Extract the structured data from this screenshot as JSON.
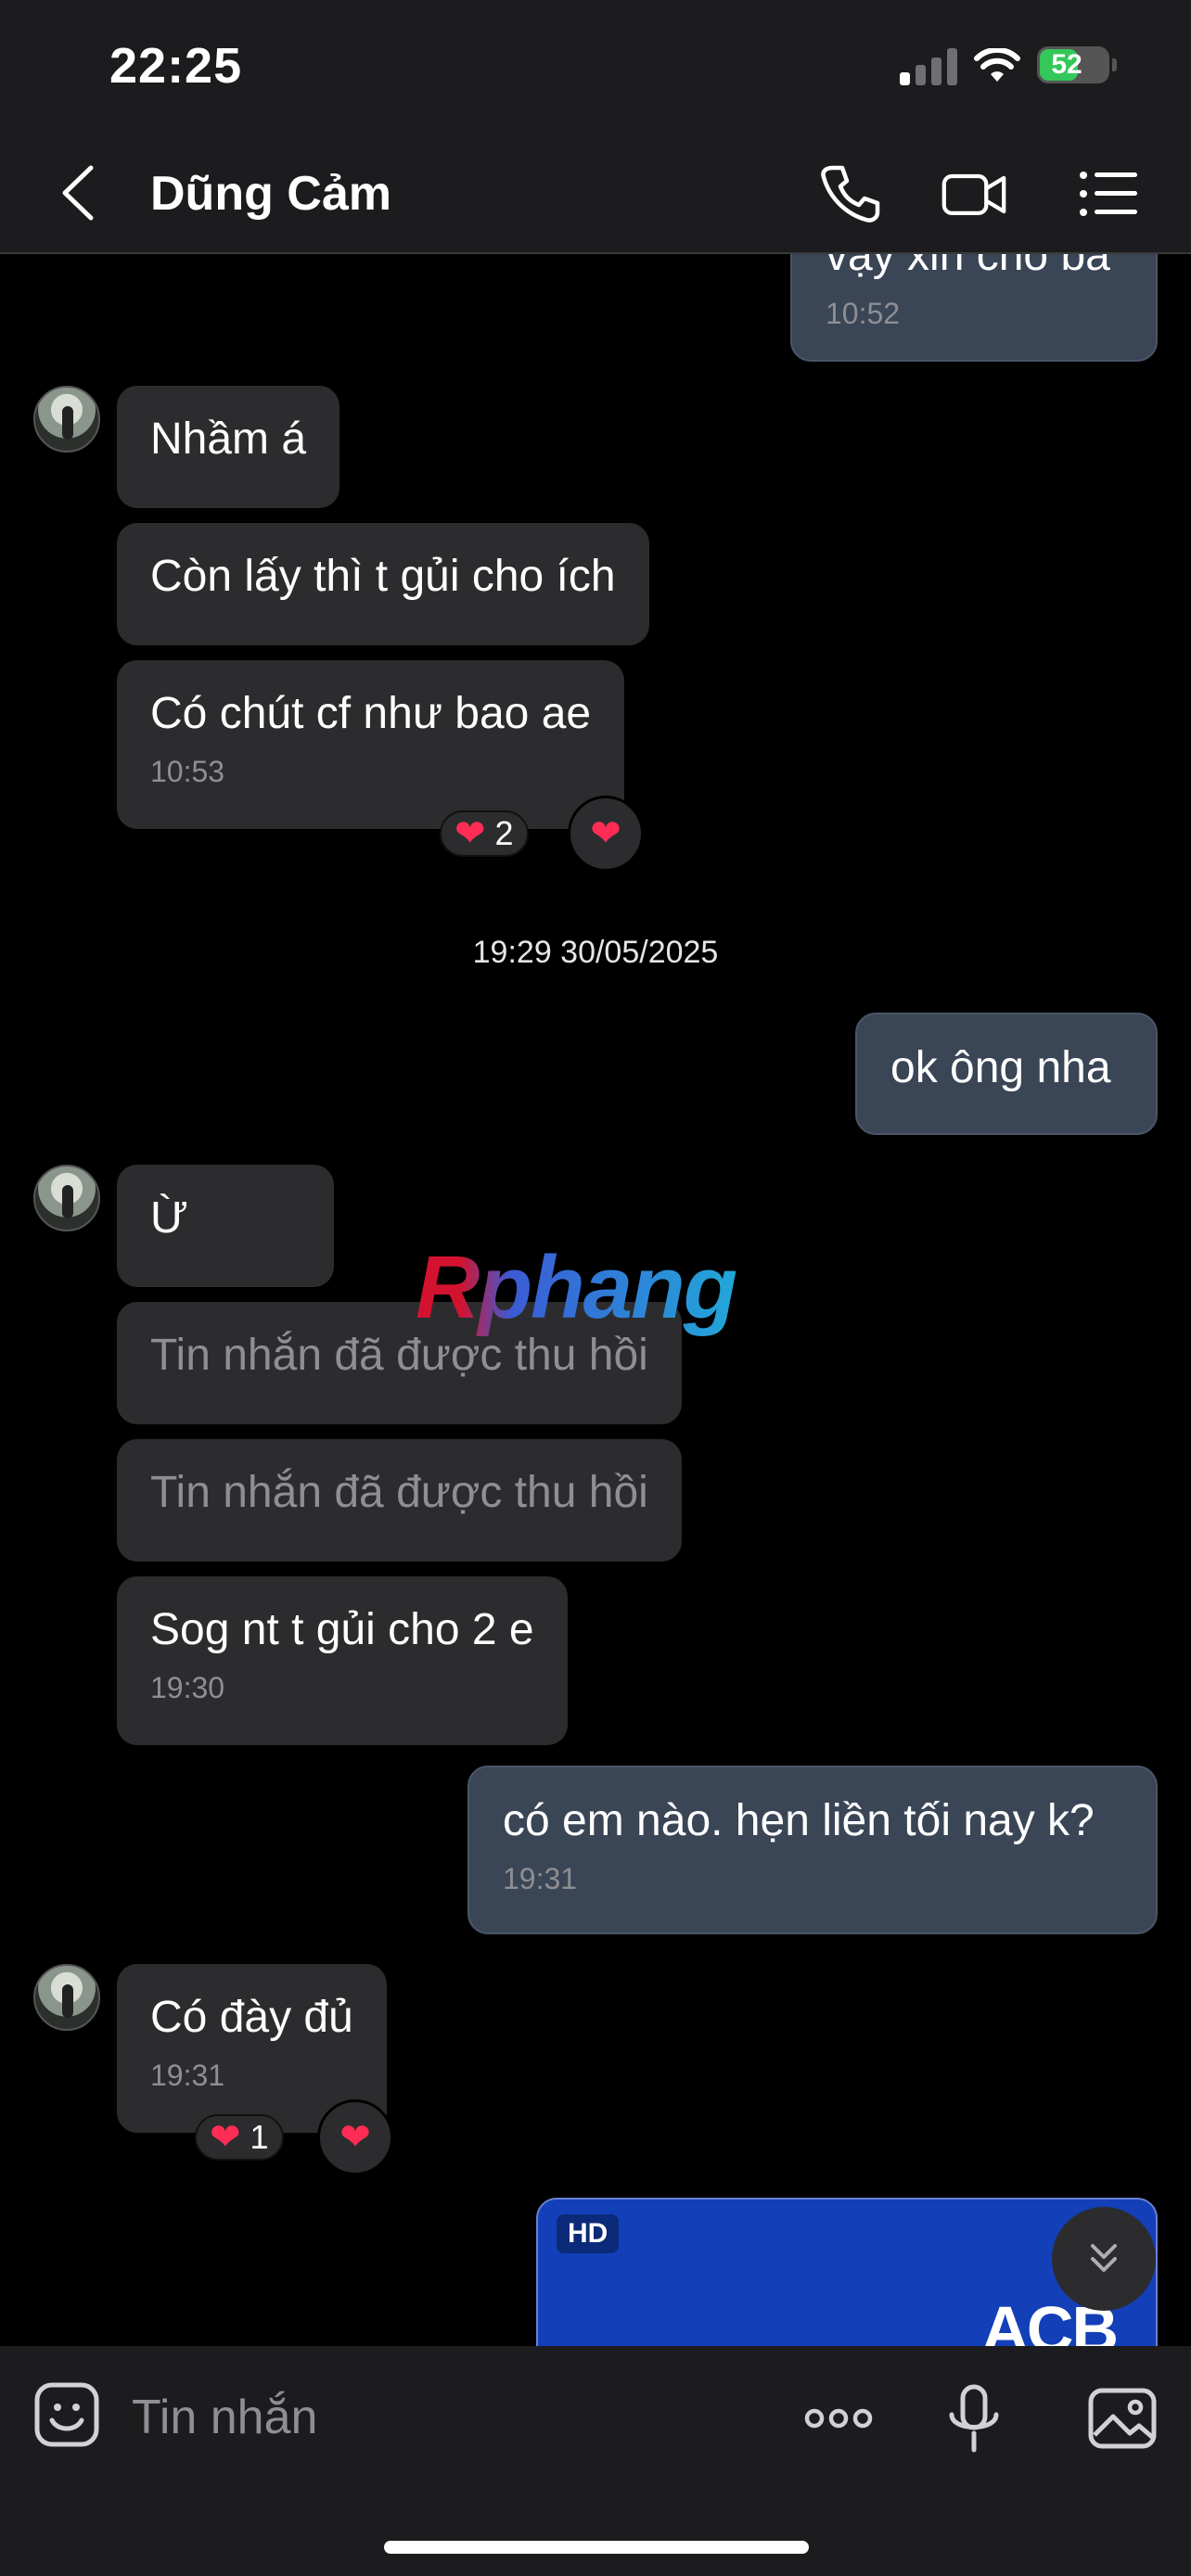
{
  "status": {
    "time": "22:25",
    "battery": "52"
  },
  "header": {
    "title": "Dũng Cảm"
  },
  "messages": {
    "m0": {
      "text": "vậy xin cho ba",
      "time": "10:52"
    },
    "m1": {
      "text": "Nhầm á"
    },
    "m2": {
      "text": "Còn lấy thì t gủi cho ích"
    },
    "m3": {
      "text": "Có chút cf như bao ae",
      "time": "10:53",
      "reaction_count": "2"
    },
    "date_separator": "19:29 30/05/2025",
    "m4": {
      "text": "ok ông nha"
    },
    "m5": {
      "text": "Ừ"
    },
    "m6": {
      "text": "Tin nhắn đã được thu hồi"
    },
    "m7": {
      "text": "Tin nhắn đã được thu hồi"
    },
    "m8": {
      "text": "Sog nt t gủi cho 2 e",
      "time": "19:30"
    },
    "m9": {
      "text": "có em nào. hẹn liền tối nay k?",
      "time": "19:31"
    },
    "m10": {
      "text": "Có đày đủ",
      "time": "19:31",
      "reaction_count": "1"
    },
    "card": {
      "badge": "HD",
      "brand": "ACB"
    }
  },
  "watermark": "Rphang",
  "composer": {
    "placeholder": "Tin nhắn"
  },
  "icons": {
    "back": "chevron-left-icon",
    "call": "phone-icon",
    "video": "video-icon",
    "menu": "list-menu-icon",
    "reaction": "heart-icon",
    "emoji": "sticker-icon",
    "more": "more-dots-icon",
    "mic": "microphone-icon",
    "image": "image-icon",
    "scroll": "double-chevron-down-icon"
  },
  "colors": {
    "incoming_bubble": "#2c2c2e",
    "outgoing_bubble": "#3a4556",
    "heart": "#ff2d55",
    "battery_green": "#34c759"
  }
}
